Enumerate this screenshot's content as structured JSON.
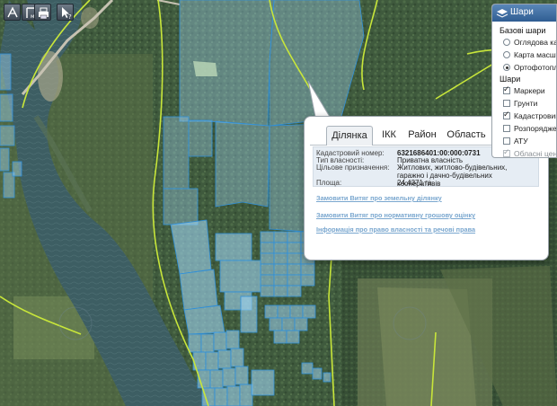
{
  "toolbar": {
    "tools": [
      {
        "name": "zoom-extent-icon"
      },
      {
        "name": "measure-icon"
      },
      {
        "name": "print-icon"
      },
      {
        "name": "identify-icon"
      }
    ]
  },
  "popup": {
    "tabs": [
      "Ділянка",
      "ІКК",
      "Район",
      "Область"
    ],
    "active_tab": "Ділянка",
    "fields": [
      {
        "label": "Кадастровий номер:",
        "value": "6321686401:00:000:0731"
      },
      {
        "label": "Тип власності:",
        "value": "Приватна власність"
      },
      {
        "label": "Цільове призначення:",
        "value": "Житлових, житлово-будівельних, гаражно і дачно-будівельних кооперативів"
      },
      {
        "label": "Площа:",
        "value": "24.4371 га"
      }
    ],
    "links": [
      "Замовити Витяг про земельну ділянку",
      "Замовити Витяг про нормативну грошову оцінку",
      "Інформація про право власності та речові права"
    ]
  },
  "layers_panel": {
    "title": "Шари",
    "base_section": "Базові шари",
    "base_layers": [
      {
        "label": "Оглядова карта",
        "selected": false
      },
      {
        "label": "Карта масштабу",
        "selected": false
      },
      {
        "label": "Ортофотоплан",
        "selected": true
      }
    ],
    "overlay_section": "Шари",
    "overlays": [
      {
        "label": "Маркери",
        "checked": true,
        "enabled": true
      },
      {
        "label": "Грунти",
        "checked": false,
        "enabled": true
      },
      {
        "label": "Кадастровий поділ",
        "checked": true,
        "enabled": true
      },
      {
        "label": "Розпорядження",
        "checked": false,
        "enabled": true
      },
      {
        "label": "АТУ",
        "checked": false,
        "enabled": true
      },
      {
        "label": "Обласні центри",
        "checked": true,
        "enabled": false
      }
    ]
  },
  "colors": {
    "parcel_fill": "#9fd3f2",
    "parcel_stroke": "#2f8fd8",
    "boundary": "#c8e63a",
    "river": "#3c5f66",
    "link": "#7aa7cf",
    "panel_header": "#2f5d92"
  }
}
